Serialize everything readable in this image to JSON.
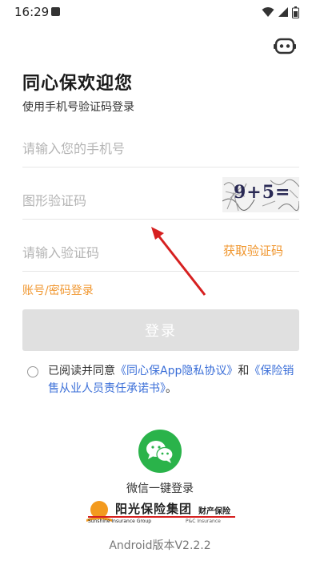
{
  "status_bar": {
    "time": "16:29",
    "notification_icon": "app-notification-icon",
    "icons": [
      "wifi-icon",
      "signal-icon",
      "battery-icon"
    ]
  },
  "header": {
    "bot_icon": "robot-icon",
    "title": "同心保欢迎您",
    "subtitle": "使用手机号验证码登录"
  },
  "form": {
    "phone_placeholder": "请输入您的手机号",
    "captcha_placeholder": "图形验证码",
    "captcha_text": "9+5=",
    "sms_placeholder": "请输入验证码",
    "get_code_label": "获取验证码",
    "account_login_label": "账号/密码登录",
    "login_label": "登录"
  },
  "agreement": {
    "prefix": "已阅读并同意",
    "privacy_link": "《同心保App隐私协议》",
    "and": "和",
    "commitment_link": "《保险销售从业人员责任承诺书》",
    "suffix": "。"
  },
  "footer": {
    "wechat_icon": "wechat-icon",
    "wechat_label": "微信一键登录",
    "logo": {
      "name_cn": "阳光保险集团",
      "name_en": "Sunshine Insurance Group",
      "division_cn": "财产保险",
      "division_en": "P&C Insurance"
    },
    "version": "Android版本V2.2.2"
  },
  "colors": {
    "accent_orange": "#f0962e",
    "link_blue": "#3b6fd8",
    "wechat_green": "#2ab34a",
    "disabled_button": "#e0e0e0",
    "annotation_red": "#d62020"
  }
}
